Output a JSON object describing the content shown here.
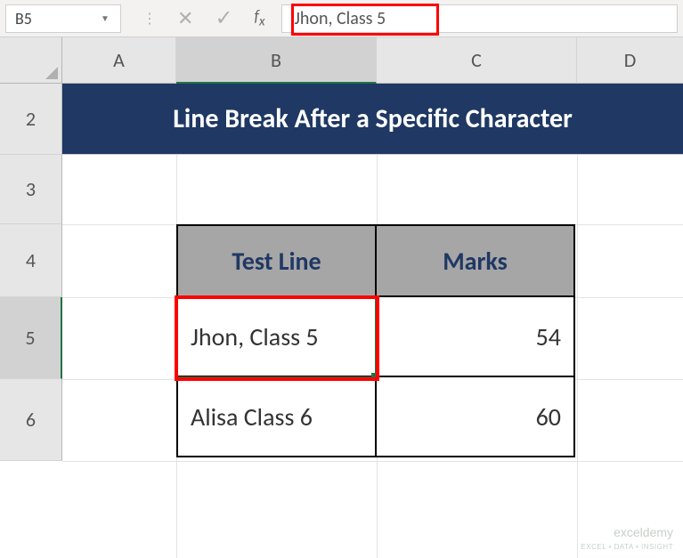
{
  "nameBox": {
    "value": "B5"
  },
  "formulaBar": {
    "value": "Jhon, Class 5"
  },
  "columns": {
    "A": "A",
    "B": "B",
    "C": "C",
    "D": "D"
  },
  "rows": {
    "r2": "2",
    "r3": "3",
    "r4": "4",
    "r5": "5",
    "r6": "6"
  },
  "title": "Line Break After a Specific Character",
  "table": {
    "headers": {
      "testLine": "Test Line",
      "marks": "Marks"
    },
    "rows": [
      {
        "testLine": "Jhon, Class 5",
        "marks": "54"
      },
      {
        "testLine": "Alisa Class 6",
        "marks": "60"
      }
    ]
  },
  "watermark": {
    "brand": "exceldemy",
    "tagline": "EXCEL • DATA • INSIGHT"
  }
}
